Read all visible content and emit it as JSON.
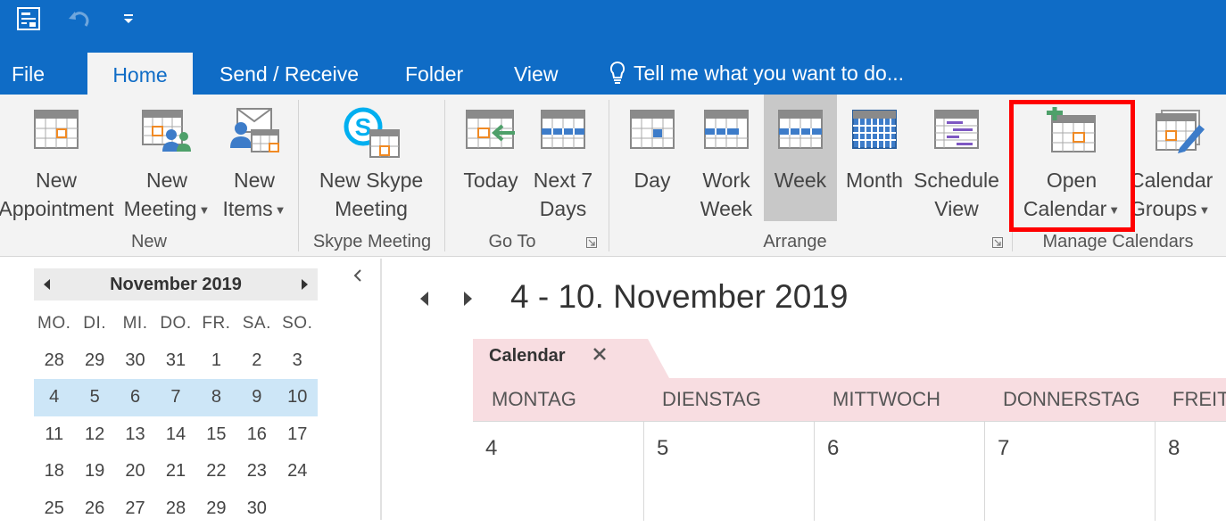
{
  "ribbon_tabs": [
    {
      "label": "File",
      "active": false
    },
    {
      "label": "Home",
      "active": true
    },
    {
      "label": "Send / Receive",
      "active": false
    },
    {
      "label": "Folder",
      "active": false
    },
    {
      "label": "View",
      "active": false
    }
  ],
  "tell_me": {
    "placeholder": "Tell me what you want to do..."
  },
  "ribbon": {
    "new_appointment": "New Appointment",
    "new_appointment_l1": "New",
    "new_appointment_l2": "Appointment",
    "new_meeting_l1": "New",
    "new_meeting_l2": "Meeting",
    "new_items_l1": "New",
    "new_items_l2": "Items",
    "group_new": "New",
    "skype_l1": "New Skype",
    "skype_l2": "Meeting",
    "group_skype": "Skype Meeting",
    "today": "Today",
    "next7_l1": "Next 7",
    "next7_l2": "Days",
    "group_goto": "Go To",
    "day": "Day",
    "workweek_l1": "Work",
    "workweek_l2": "Week",
    "week": "Week",
    "month": "Month",
    "schedule_l1": "Schedule",
    "schedule_l2": "View",
    "group_arrange": "Arrange",
    "open_cal_l1": "Open",
    "open_cal_l2": "Calendar",
    "cal_groups_l1": "Calendar",
    "cal_groups_l2": "Groups",
    "group_manage": "Manage Calendars"
  },
  "mini_calendar": {
    "title": "November 2019",
    "weekdays": [
      "MO.",
      "DI.",
      "MI.",
      "DO.",
      "FR.",
      "SA.",
      "SO."
    ],
    "weeks": [
      [
        "28",
        "29",
        "30",
        "31",
        "1",
        "2",
        "3"
      ],
      [
        "4",
        "5",
        "6",
        "7",
        "8",
        "9",
        "10"
      ],
      [
        "11",
        "12",
        "13",
        "14",
        "15",
        "16",
        "17"
      ],
      [
        "18",
        "19",
        "20",
        "21",
        "22",
        "23",
        "24"
      ],
      [
        "25",
        "26",
        "27",
        "28",
        "29",
        "30",
        ""
      ]
    ],
    "selected_week": 1
  },
  "main": {
    "title": "4 - 10. November 2019",
    "calendar_tab": "Calendar",
    "days": [
      {
        "name": "MONTAG",
        "num": "4"
      },
      {
        "name": "DIENSTAG",
        "num": "5"
      },
      {
        "name": "MITTWOCH",
        "num": "6"
      },
      {
        "name": "DONNERSTAG",
        "num": "7"
      },
      {
        "name": "FREITAG",
        "num": "8"
      }
    ]
  },
  "colors": {
    "accent": "#0f6cc6",
    "highlight_box": "#ff0000",
    "selected_week": "#cde6f7",
    "day_header": "#f8dde1"
  }
}
